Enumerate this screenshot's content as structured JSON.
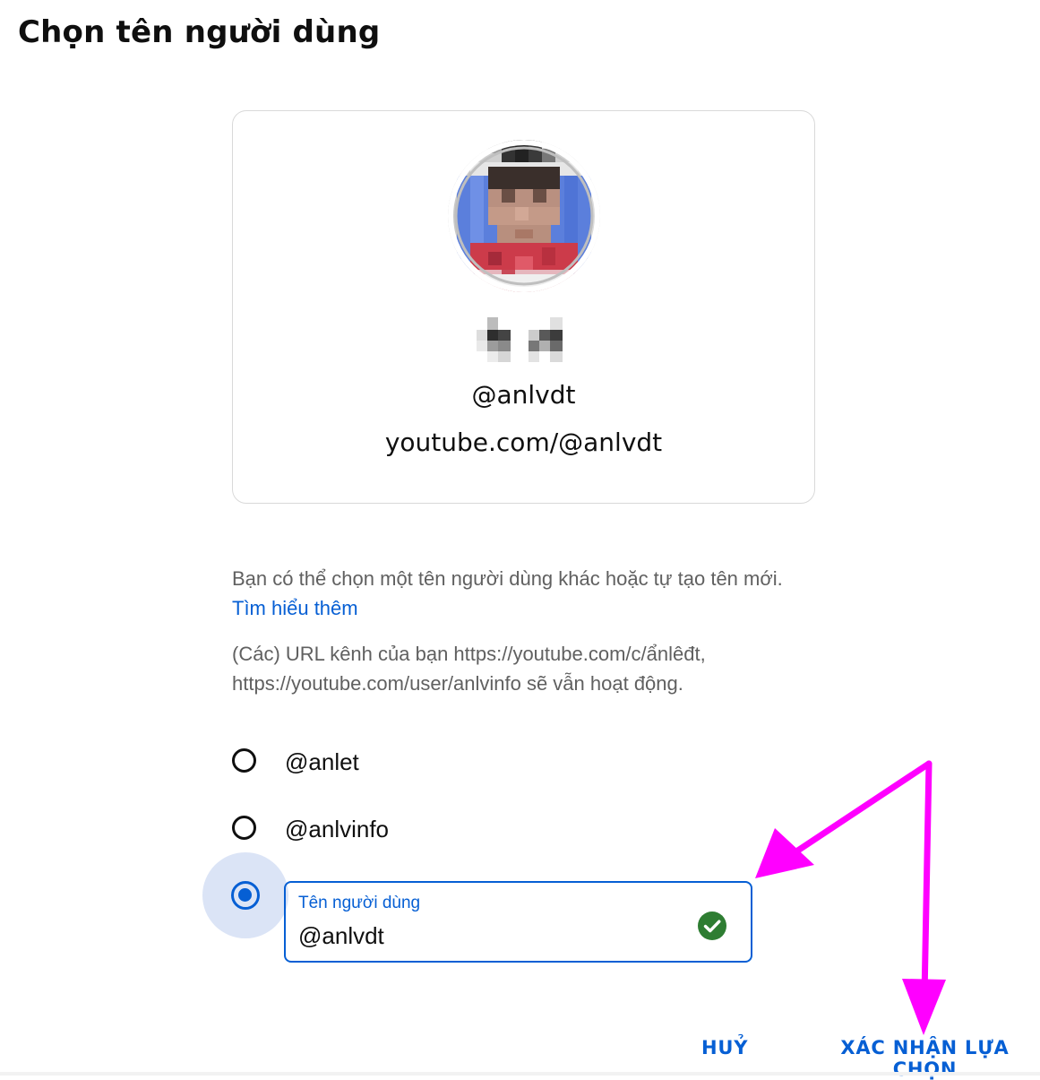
{
  "dialog": {
    "title": "Chọn tên người dùng"
  },
  "preview": {
    "handle": "@anlvdt",
    "channel_url": "youtube.com/@anlvdt"
  },
  "info": {
    "line1": "Bạn có thể chọn một tên người dùng khác hoặc tự tạo tên mới.",
    "learn_more": "Tìm hiểu thêm",
    "line2a": "(Các) URL kênh của bạn https://youtube.com/c/ẩnlêđt,",
    "line2b": "https://youtube.com/user/anlvinfo sẽ vẫn hoạt động."
  },
  "options": [
    {
      "label": "@anlet",
      "selected": false
    },
    {
      "label": "@anlvinfo",
      "selected": false
    }
  ],
  "custom": {
    "label": "Tên người dùng",
    "value": "@anlvdt",
    "selected": true,
    "valid": true
  },
  "actions": {
    "cancel": "HUỶ",
    "confirm": "XÁC NHẬN LỰA CHỌN"
  },
  "colors": {
    "accent": "#065fd4",
    "valid": "#2e7d32",
    "annotation": "#ff00ff"
  },
  "icons": {
    "valid": "check-circle-icon"
  }
}
